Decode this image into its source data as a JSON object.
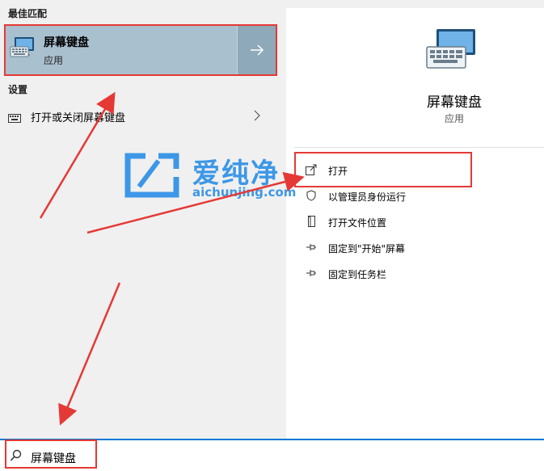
{
  "left": {
    "best_match_header": "最佳匹配",
    "best_match": {
      "title": "屏幕键盘",
      "subtitle": "应用"
    },
    "settings_header": "设置",
    "settings_items": [
      {
        "label": "打开或关闭屏幕键盘"
      }
    ]
  },
  "right": {
    "app_title": "屏幕键盘",
    "app_subtitle": "应用",
    "actions": [
      {
        "label": "打开",
        "icon": "open-icon"
      },
      {
        "label": "以管理员身份运行",
        "icon": "shield-icon"
      },
      {
        "label": "打开文件位置",
        "icon": "file-location-icon"
      },
      {
        "label": "固定到\"开始\"屏幕",
        "icon": "pin-icon"
      },
      {
        "label": "固定到任务栏",
        "icon": "pin-icon"
      }
    ]
  },
  "search": {
    "value": "屏幕键盘",
    "icon": "search-icon"
  },
  "watermark": {
    "title": "爱纯净",
    "url": "aichunjing.com"
  },
  "colors": {
    "accent": "#0078d7",
    "highlight": "#a9c0cf",
    "annotation_red": "#e53935",
    "watermark_blue": "#1e88e5"
  }
}
